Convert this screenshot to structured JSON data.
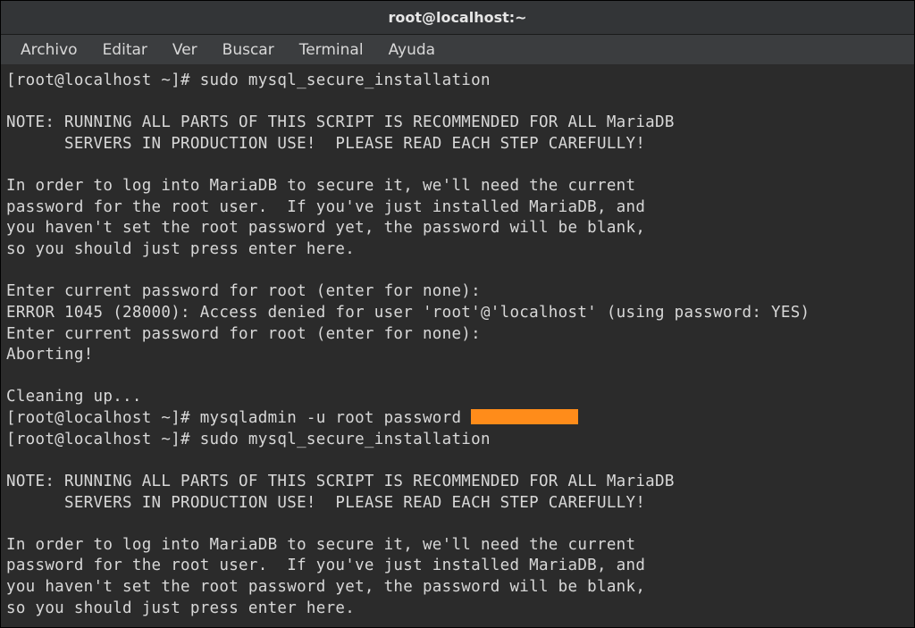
{
  "titlebar": {
    "title": "root@localhost:~"
  },
  "menubar": {
    "items": [
      "Archivo",
      "Editar",
      "Ver",
      "Buscar",
      "Terminal",
      "Ayuda"
    ]
  },
  "terminal": {
    "prompt": "[root@localhost ~]# ",
    "cmd1": "sudo mysql_secure_installation",
    "blank": "",
    "note1": "NOTE: RUNNING ALL PARTS OF THIS SCRIPT IS RECOMMENDED FOR ALL MariaDB",
    "note2": "      SERVERS IN PRODUCTION USE!  PLEASE READ EACH STEP CAREFULLY!",
    "para1": "In order to log into MariaDB to secure it, we'll need the current",
    "para2": "password for the root user.  If you've just installed MariaDB, and",
    "para3": "you haven't set the root password yet, the password will be blank,",
    "para4": "so you should just press enter here.",
    "enter1": "Enter current password for root (enter for none):",
    "error": "ERROR 1045 (28000): Access denied for user 'root'@'localhost' (using password: YES)",
    "enter2": "Enter current password for root (enter for none):",
    "abort": "Aborting!",
    "clean": "Cleaning up...",
    "cmd2": "mysqladmin -u root password ",
    "cmd3": "sudo mysql_secure_installation"
  }
}
